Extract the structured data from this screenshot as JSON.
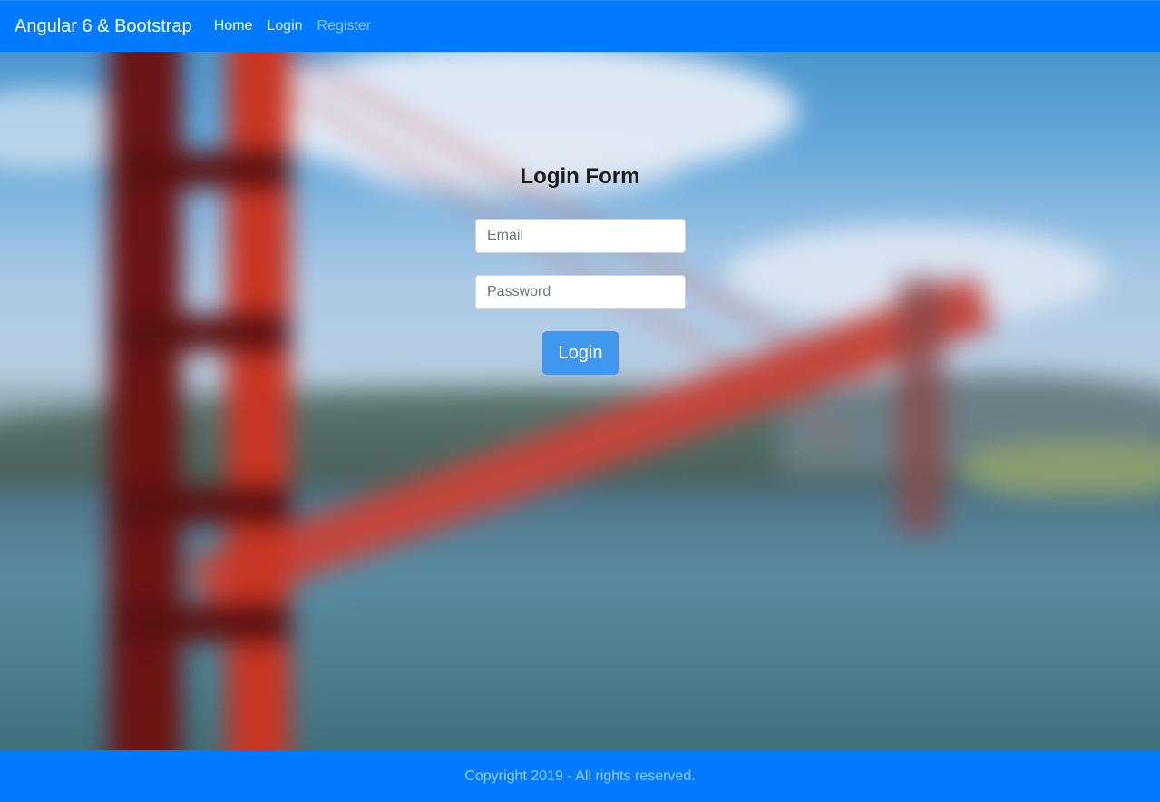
{
  "navbar": {
    "brand": "Angular 6 & Bootstrap",
    "links": [
      {
        "label": "Home",
        "state": "active"
      },
      {
        "label": "Login",
        "state": "normal"
      },
      {
        "label": "Register",
        "state": "muted"
      }
    ]
  },
  "background": {
    "subject": "blurred Golden Gate Bridge photo"
  },
  "login_form": {
    "title": "Login Form",
    "email_placeholder": "Email",
    "email_value": "",
    "password_placeholder": "Password",
    "password_value": "",
    "submit_label": "Login"
  },
  "footer": {
    "copyright": "Copyright 2019 - All rights reserved."
  },
  "colors": {
    "primary": "#007bff",
    "button": "#3f97ee",
    "title_text": "#1b1b1b"
  }
}
